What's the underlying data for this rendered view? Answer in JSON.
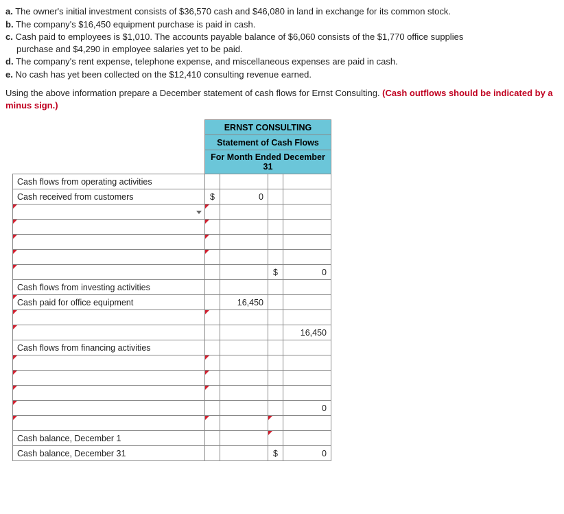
{
  "items": {
    "a": {
      "label": "a.",
      "text": "The owner's initial investment consists of $36,570 cash and $46,080 in land in exchange for its common stock."
    },
    "b": {
      "label": "b.",
      "text": "The company's $16,450 equipment purchase is paid in cash."
    },
    "c": {
      "label": "c.",
      "text1": "Cash paid to employees is $1,010. The accounts payable balance of $6,060 consists of the $1,770 office supplies",
      "text2": "purchase and $4,290 in employee salaries yet to be paid."
    },
    "d": {
      "label": "d.",
      "text": "The company's rent expense, telephone expense, and miscellaneous expenses are paid in cash."
    },
    "e": {
      "label": "e.",
      "text": "No cash has yet been collected on the $12,410 consulting revenue earned."
    }
  },
  "instruction": {
    "main": "Using the above information prepare a December statement of cash flows for Ernst Consulting. ",
    "red": "(Cash outflows should be indicated by a minus sign.)"
  },
  "headers": {
    "company": "ERNST CONSULTING",
    "title": "Statement of Cash Flows",
    "period": "For Month Ended December 31"
  },
  "rows": {
    "op_header": "Cash flows from operating activities",
    "op_r1_label": "Cash received from customers",
    "op_r1_sym": "$",
    "op_r1_val": "0",
    "op_total_sym": "$",
    "op_total_val": "0",
    "inv_header": "Cash flows from investing activities",
    "inv_r1_label": "Cash paid for office equipment",
    "inv_r1_val": "16,450",
    "inv_total_val": "16,450",
    "fin_header": "Cash flows from financing activities",
    "fin_total_val": "0",
    "bal_begin": "Cash balance, December 1",
    "bal_end": "Cash balance, December 31",
    "bal_end_sym": "$",
    "bal_end_val": "0"
  }
}
